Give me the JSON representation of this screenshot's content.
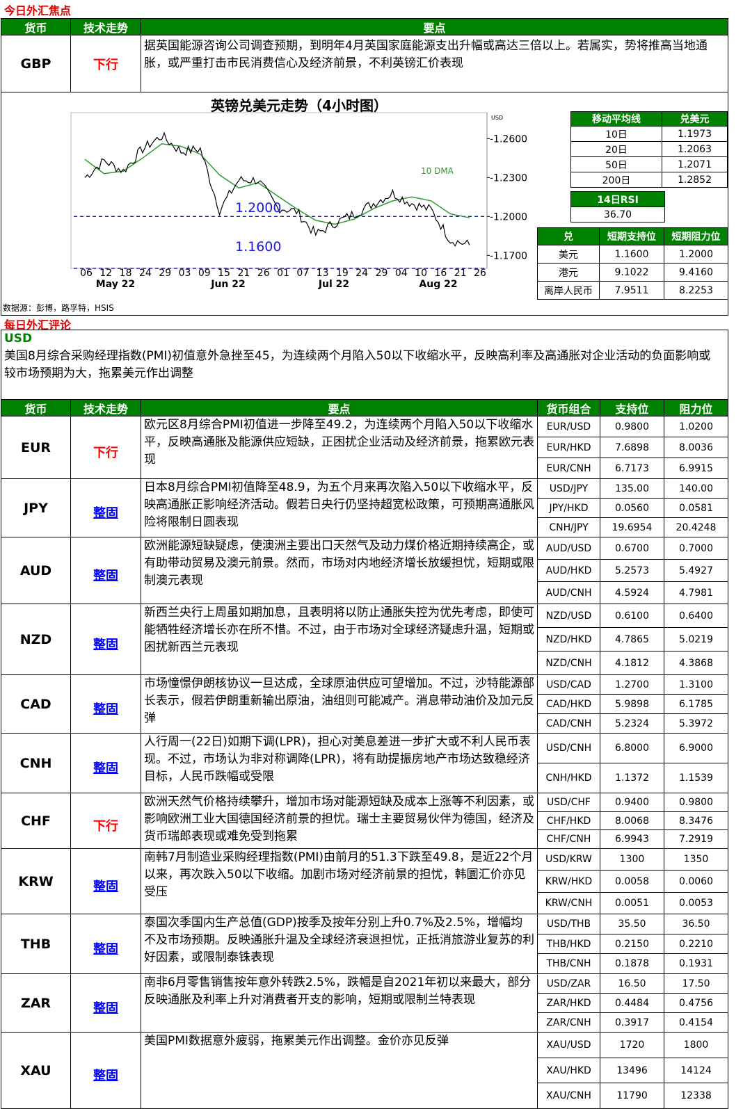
{
  "focus_title": "今日外汇焦点",
  "headers": {
    "currency": "货币",
    "trend": "技术走势",
    "points": "要点",
    "pair": "货币组合",
    "support": "支持位",
    "resistance": "阻力位"
  },
  "gbp": {
    "currency": "GBP",
    "trend": "下行",
    "point": "据英国能源咨询公司调查预期，到明年4月英国家庭能源支出升幅或高达三倍以上。若属实，势将推高当地通胀，或严重打击市民消费信心及经济前景，不利英镑汇价表现"
  },
  "chart": {
    "title": "英镑兑美元走势（4小时图）",
    "unit": "USD",
    "dma_label": "10 DMA",
    "line1_label": "1.2000",
    "line2_label": "1.1600",
    "y_ticks": [
      "1.2600",
      "1.2300",
      "1.2000",
      "1.1700"
    ],
    "x_ticks": [
      "06",
      "12",
      "18",
      "24",
      "29",
      "03",
      "09",
      "15",
      "21",
      "26",
      "01",
      "07",
      "13",
      "19",
      "24",
      "29",
      "04",
      "10",
      "16",
      "21",
      "26"
    ],
    "months": [
      "May 22",
      "Jun 22",
      "Jul 22",
      "Aug 22"
    ]
  },
  "chart_data": {
    "type": "line",
    "title": "英镑兑美元走势（4小时图）",
    "ylabel": "USD",
    "ylim": [
      1.16,
      1.28
    ],
    "x": [
      "May 06",
      "May 12",
      "May 18",
      "May 24",
      "May 29",
      "Jun 03",
      "Jun 09",
      "Jun 15",
      "Jun 21",
      "Jun 26",
      "Jul 01",
      "Jul 07",
      "Jul 13",
      "Jul 19",
      "Jul 24",
      "Jul 29",
      "Aug 04",
      "Aug 10",
      "Aug 16",
      "Aug 21",
      "Aug 23"
    ],
    "series": [
      {
        "values": [
          1.23,
          1.243,
          1.235,
          1.252,
          1.262,
          1.25,
          1.252,
          1.205,
          1.228,
          1.228,
          1.207,
          1.204,
          1.186,
          1.195,
          1.202,
          1.21,
          1.218,
          1.21,
          1.205,
          1.182,
          1.178
        ]
      },
      {
        "name": "10 DMA",
        "values": [
          1.244,
          1.233,
          1.235,
          1.245,
          1.256,
          1.254,
          1.248,
          1.232,
          1.222,
          1.226,
          1.216,
          1.206,
          1.197,
          1.194,
          1.198,
          1.206,
          1.212,
          1.215,
          1.212,
          1.202,
          1.199
        ]
      }
    ],
    "hlines": [
      1.2,
      1.16
    ]
  },
  "ma_table": {
    "h1": "移动平均线",
    "h2": "兑美元",
    "rows": [
      [
        "10日",
        "1.1973"
      ],
      [
        "20日",
        "1.2063"
      ],
      [
        "50日",
        "1.2071"
      ],
      [
        "200日",
        "1.2852"
      ]
    ],
    "rsi_label": "14日RSI",
    "rsi_value": "36.70"
  },
  "sr_table": {
    "h1": "兑",
    "h2": "短期支持位",
    "h3": "短期阻力位",
    "rows": [
      [
        "美元",
        "1.1600",
        "1.2000"
      ],
      [
        "港元",
        "9.1022",
        "9.4160"
      ],
      [
        "离岸人民币",
        "7.9511",
        "8.2253"
      ]
    ]
  },
  "source": "数据源：彭博，路孚特，HSIS",
  "review_title": "每日外汇评论",
  "usd": {
    "label": "USD",
    "text": "美国8月综合采购经理指数(PMI)初值意外急挫至45，为连续两个月陷入50以下收缩水平，反映高利率及高通胀对企业活动的负面影响或较市场预期为大，拖累美元作出调整"
  },
  "rows": [
    {
      "currency": "EUR",
      "trend": "下行",
      "point": "欧元区8月综合PMI初值进一步降至49.2，为连续两个月陷入50以下收缩水平，反映高通胀及能源供应短缺，正困扰企业活动及经济前景，拖累欧元表现",
      "pairs": [
        [
          "EUR/USD",
          "0.9800",
          "1.0200"
        ],
        [
          "EUR/HKD",
          "7.6898",
          "8.0036"
        ],
        [
          "EUR/CNH",
          "6.7173",
          "6.9915"
        ]
      ]
    },
    {
      "currency": "JPY",
      "trend": "整固",
      "point": "日本8月综合PMI初值降至48.9，为五个月来再次陷入50以下收缩水平，反映高通胀正影响经济活动。假若日央行仍坚持超宽松政策，可预期高通胀风险将限制日圆表现",
      "pairs": [
        [
          "USD/JPY",
          "135.00",
          "140.00"
        ],
        [
          "JPY/HKD",
          "0.0560",
          "0.0581"
        ],
        [
          "CNH/JPY",
          "19.6954",
          "20.4248"
        ]
      ]
    },
    {
      "currency": "AUD",
      "trend": "整固",
      "point": "欧洲能源短缺疑虑，使澳洲主要出口天然气及动力煤价格近期持续高企，或有助带动贸易及澳元前景。然而，市场对内地经济增长放缓担忧，短期或限制澳元表现",
      "pairs": [
        [
          "AUD/USD",
          "0.6700",
          "0.7000"
        ],
        [
          "AUD/HKD",
          "5.2573",
          "5.4927"
        ],
        [
          "AUD/CNH",
          "4.5924",
          "4.7981"
        ]
      ]
    },
    {
      "currency": "NZD",
      "trend": "整固",
      "point": "新西兰央行上周虽如期加息，且表明将以防止通胀失控为优先考虑，即使可能牺牲经济增长亦在所不惜。不过，由于市场对全球经济疑虑升温，短期或困扰新西兰元表现",
      "pairs": [
        [
          "NZD/USD",
          "0.6100",
          "0.6400"
        ],
        [
          "NZD/HKD",
          "4.7865",
          "5.0219"
        ],
        [
          "NZD/CNH",
          "4.1812",
          "4.3868"
        ]
      ]
    },
    {
      "currency": "CAD",
      "trend": "整固",
      "point": "市场憧憬伊朗核协议一旦达成，全球原油供应可望增加。不过，沙特能源部长表示，假若伊朗重新输出原油，油组则可能减产。消息带动油价及加元反弹",
      "pairs": [
        [
          "USD/CAD",
          "1.2700",
          "1.3100"
        ],
        [
          "CAD/HKD",
          "5.9898",
          "6.1785"
        ],
        [
          "CAD/CNH",
          "5.2324",
          "5.3972"
        ]
      ]
    },
    {
      "currency": "CNH",
      "trend": "整固",
      "point": "人行周一(22日)如期下调(LPR)，担心对美息差进一步扩大或不利人民币表现。不过，市场认为非对称调降(LPR)，将有助提振房地产市场达致稳经济目标，人民币跌幅或受限",
      "pairs": [
        [
          "USD/CNH",
          "6.8000",
          "6.9000"
        ],
        [
          "CNH/HKD",
          "1.1372",
          "1.1539"
        ]
      ]
    },
    {
      "currency": "CHF",
      "trend": "下行",
      "point": "欧洲天然气价格持续攀升，增加市场对能源短缺及成本上涨等不利因素，或影响欧洲工业大国德国经济前景的担忧。瑞士主要贸易伙伴为德国，经济及货币瑞郎表现或难免受到拖累",
      "pairs": [
        [
          "USD/CHF",
          "0.9400",
          "0.9800"
        ],
        [
          "CHF/HKD",
          "8.0068",
          "8.3476"
        ],
        [
          "CHF/CNH",
          "6.9943",
          "7.2919"
        ]
      ]
    },
    {
      "currency": "KRW",
      "trend": "整固",
      "point": "南韩7月制造业采购经理指数(PMI)由前月的51.3下跌至49.8，是近22个月以来，再次跌入50以下收缩。加剧市场对经济前景的担忧，韩圜汇价亦见受压",
      "pairs": [
        [
          "USD/KRW",
          "1300",
          "1350"
        ],
        [
          "KRW/HKD",
          "0.0058",
          "0.0060"
        ],
        [
          "KRW/CNH",
          "0.0051",
          "0.0053"
        ]
      ]
    },
    {
      "currency": "THB",
      "trend": "整固",
      "point": "泰国次季国内生产总值(GDP)按季及按年分别上升0.7%及2.5%，增幅均不及市场预期。反映通胀升温及全球经济衰退担忧，正抵消旅游业复苏的利好因素，或限制泰铢表现",
      "pairs": [
        [
          "USD/THB",
          "35.50",
          "36.50"
        ],
        [
          "THB/HKD",
          "0.2150",
          "0.2210"
        ],
        [
          "THB/CNH",
          "0.1878",
          "0.1931"
        ]
      ]
    },
    {
      "currency": "ZAR",
      "trend": "整固",
      "point": "南非6月零售销售按年意外转跌2.5%，跌幅是自2021年初以来最大，部分反映通胀及利率上升对消费者开支的影响，短期或限制兰特表现",
      "pairs": [
        [
          "USD/ZAR",
          "16.50",
          "17.50"
        ],
        [
          "ZAR/HKD",
          "0.4484",
          "0.4756"
        ],
        [
          "ZAR/CNH",
          "0.3917",
          "0.4154"
        ]
      ]
    },
    {
      "currency": "XAU",
      "trend": "整固",
      "point": "美国PMI数据意外疲弱，拖累美元作出调整。金价亦见反弹",
      "pairs": [
        [
          "XAU/USD",
          "1720",
          "1800"
        ],
        [
          "XAU/HKD",
          "13496",
          "14124"
        ],
        [
          "XAU/CNH",
          "11790",
          "12338"
        ]
      ]
    }
  ],
  "colors": {
    "green": "#008000",
    "red": "#ff0000",
    "blue": "#0000ff",
    "dashed": "#1a1ad8"
  }
}
